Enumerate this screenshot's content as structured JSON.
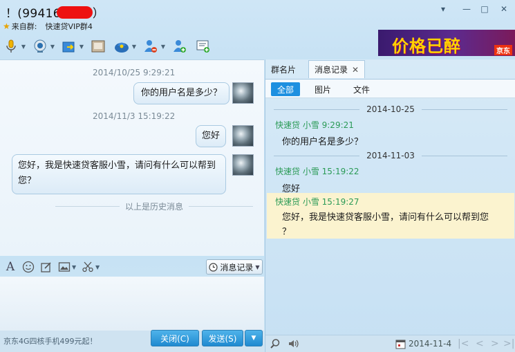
{
  "window": {
    "title_prefix": "！(99416",
    "title_suffix": "）",
    "from_group_label": "来自群:",
    "group_name": "快速贷VIP群4",
    "controls": [
      "▾",
      "—",
      "□",
      "✕"
    ]
  },
  "ad": {
    "text": "价格已醉",
    "tail": "京东"
  },
  "chat": {
    "messages": [
      {
        "timestamp": "2014/10/25 9:29:21",
        "text": "你的用户名是多少？"
      },
      {
        "timestamp": "2014/11/3 15:19:22",
        "text": "您好"
      },
      {
        "timestamp": "",
        "text_line1": "您好，我是快速贷客服小雪，请问有什么可以帮到",
        "text_line2": "您？"
      }
    ],
    "history_divider": "以上是历史消息"
  },
  "input": {
    "history_button": "消息记录",
    "promo_text": "京东4G四核手机499元起！",
    "close_button": "关闭(C)",
    "send_button": "发送(S)"
  },
  "right": {
    "tabs": [
      "群名片",
      "消息记录"
    ],
    "tab_close": "✕",
    "filters": [
      "全部",
      "图片",
      "文件"
    ],
    "date1": "2014-10-25",
    "entry1": {
      "sender": "快速贷 小雪 9:29:21",
      "text": "你的用户名是多少？"
    },
    "date2": "2014-11-03",
    "entry2": {
      "sender": "快速贷 小雪 15:19:22",
      "text": "您好"
    },
    "entry3": {
      "sender": "快速贷 小雪 15:19:27",
      "text_line1": "您好，我是快速贷客服小雪，请问有什么可以帮到您",
      "text_line2": "？"
    },
    "current_date": "2014-11-4"
  },
  "colors": {
    "accent": "#1e90e0",
    "sender_green": "#2a9a56",
    "highlight": "#fbf3cf"
  }
}
